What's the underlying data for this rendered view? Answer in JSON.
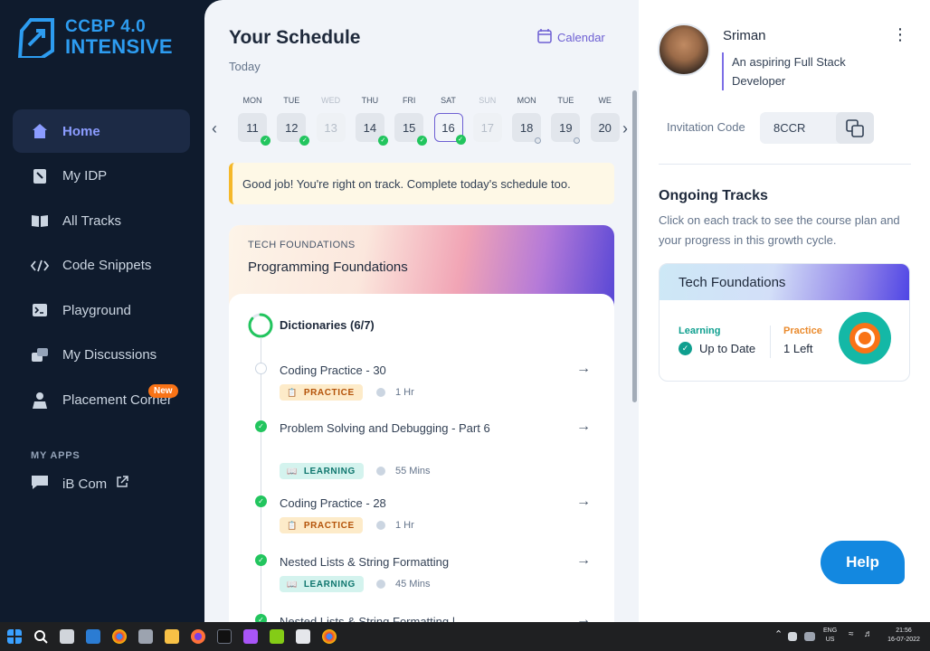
{
  "brand": {
    "line1": "CCBP 4.0",
    "line2": "INTENSIVE",
    "color": "#2d9cf0"
  },
  "sidebar": {
    "items": [
      {
        "label": "Home",
        "icon": "home-icon",
        "active": true
      },
      {
        "label": "My IDP",
        "icon": "idp-icon"
      },
      {
        "label": "All Tracks",
        "icon": "book-icon"
      },
      {
        "label": "Code Snippets",
        "icon": "code-icon"
      },
      {
        "label": "Playground",
        "icon": "terminal-icon"
      },
      {
        "label": "My Discussions",
        "icon": "discussion-icon"
      },
      {
        "label": "Placement Corner",
        "icon": "placement-icon",
        "badge": "New"
      }
    ],
    "apps_title": "MY APPS",
    "apps": [
      {
        "label": "iB Com",
        "icon": "chat-icon"
      }
    ]
  },
  "schedule": {
    "title": "Your Schedule",
    "subtitle": "Today",
    "calendar_label": "Calendar",
    "days": [
      {
        "name": "MON",
        "num": "11",
        "state": "done"
      },
      {
        "name": "TUE",
        "num": "12",
        "state": "done"
      },
      {
        "name": "WED",
        "num": "13",
        "state": "off"
      },
      {
        "name": "THU",
        "num": "14",
        "state": "done"
      },
      {
        "name": "FRI",
        "num": "15",
        "state": "done"
      },
      {
        "name": "SAT",
        "num": "16",
        "state": "selected"
      },
      {
        "name": "SUN",
        "num": "17",
        "state": "off"
      },
      {
        "name": "MON",
        "num": "18",
        "state": "pending"
      },
      {
        "name": "TUE",
        "num": "19",
        "state": "pending"
      },
      {
        "name": "WE",
        "num": "20",
        "state": "normal"
      }
    ],
    "notice": "Good job! You're right on track. Complete today's schedule too."
  },
  "track": {
    "category": "TECH FOUNDATIONS",
    "course": "Programming Foundations",
    "module": "Dictionaries (6/7)",
    "module_progress": 0.857,
    "tasks": [
      {
        "name": "Coding Practice - 30",
        "type": "PRACTICE",
        "duration": "1 Hr",
        "done": false
      },
      {
        "name": "Problem Solving and Debugging - Part 6",
        "type": "LEARNING",
        "duration": "55 Mins",
        "done": true
      },
      {
        "name": "Coding Practice - 28",
        "type": "PRACTICE",
        "duration": "1 Hr",
        "done": true
      },
      {
        "name": "Nested Lists & String Formatting",
        "type": "LEARNING",
        "duration": "45 Mins",
        "done": true
      },
      {
        "name": "Nested Lists & String Formatting |",
        "type": "",
        "duration": "",
        "done": true
      }
    ]
  },
  "profile": {
    "name": "Sriman",
    "bio": "An aspiring Full Stack Developer",
    "invitation_label": "Invitation Code",
    "invitation_code": "8CCR"
  },
  "ongoing": {
    "title": "Ongoing Tracks",
    "description": "Click on each track to see the course plan and your progress in this growth cycle.",
    "card": {
      "title": "Tech Foundations",
      "learning_label": "Learning",
      "learning_value": "Up to Date",
      "practice_label": "Practice",
      "practice_value": "1 Left"
    }
  },
  "help_label": "Help",
  "taskbar": {
    "lang1": "ENG",
    "lang2": "US",
    "time": "21:56",
    "date": "16-07-2022"
  }
}
